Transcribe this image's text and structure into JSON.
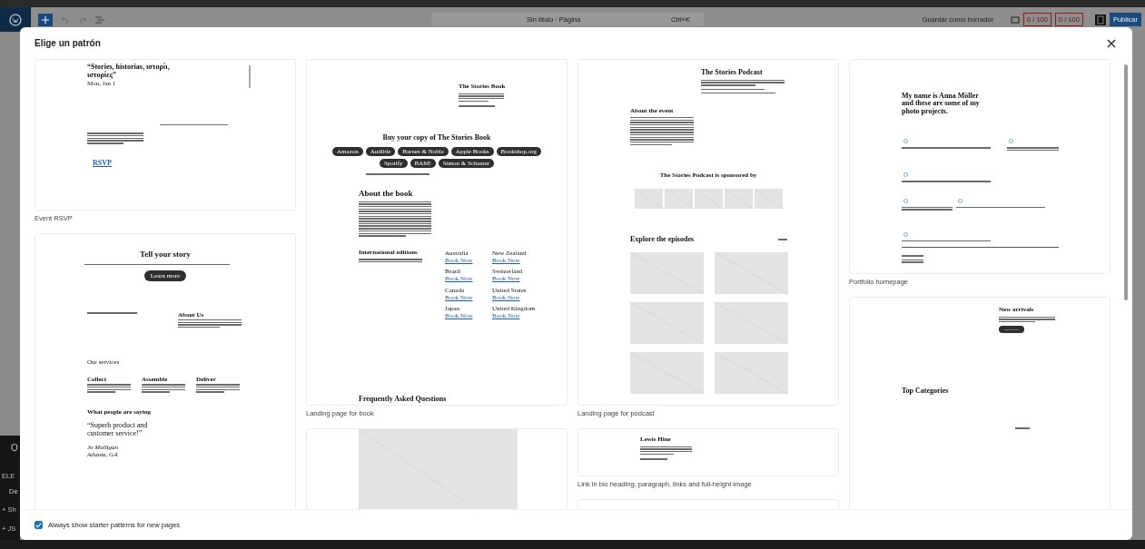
{
  "editor_bar": {
    "title": "Sin título · Página",
    "shortcut": "Ctrl+K",
    "save_draft": "Guardar como borrador",
    "counters": [
      "0 / 100",
      "0 / 100"
    ],
    "publish": "Publicar"
  },
  "side_panel": {
    "items": [
      "O",
      "ELE",
      "De",
      "+ Sh",
      "+ JS"
    ]
  },
  "modal": {
    "title": "Elige un patrón",
    "columns": [
      [
        {
          "kind": "event",
          "label": "Event RSVP",
          "heading": "“Stories, historias, ιστορίι, ιστορίες”",
          "date": "Mon, Jan 1",
          "link": "RSVP"
        },
        {
          "kind": "story",
          "heading": "Tell your story",
          "button": "Learn more",
          "about": "About Us",
          "services": "Our services",
          "service_titles": [
            "Collect",
            "Assemble",
            "Deliver"
          ],
          "quote_heading": "What people are saying",
          "quote": "“Superb product and customer service!”",
          "author": "Jo Mulligan",
          "place": "Atlanta, GA"
        }
      ],
      [
        {
          "kind": "book",
          "label": "Landing page for book",
          "title": "The Stories Book",
          "buy_heading": "Buy your copy of The Stories Book",
          "stores": [
            "Amazon",
            "Audible",
            "Barnes & Noble",
            "Apple Books",
            "Bookshop.org",
            "Spotify",
            "BAM!",
            "Simon & Schuster"
          ],
          "about": "About the book",
          "editions": "International editions",
          "countries": [
            {
              "name": "Australia",
              "link": "Book Now"
            },
            {
              "name": "Brazil",
              "link": "Book Now"
            },
            {
              "name": "Canada",
              "link": "Book Now"
            },
            {
              "name": "Japan",
              "link": "Book Now"
            },
            {
              "name": "New Zealand",
              "link": "Book Now"
            },
            {
              "name": "Switzerland",
              "link": "Book Now"
            },
            {
              "name": "United States",
              "link": "Book Now"
            },
            {
              "name": "United Kingdom",
              "link": "Book Now"
            }
          ],
          "faq": "Frequently Asked Questions"
        },
        {
          "kind": "image"
        }
      ],
      [
        {
          "kind": "podcast",
          "label": "Landing page for podcast",
          "title": "The Stories Podcast",
          "about": "About the event",
          "sponsored": "The Stories Podcast is sponsored by",
          "episodes": "Explore the episodes"
        },
        {
          "kind": "bio",
          "label": "Link in bio heading, paragraph, links and full-height image",
          "name": "Lewis Hine"
        },
        {
          "kind": "blank"
        }
      ],
      [
        {
          "kind": "portfolio",
          "label": "Portfolio homepage",
          "heading": "My name is Anna Möller and these are some of my photo projects."
        },
        {
          "kind": "shop",
          "heading": "New arrivals",
          "categories": "Top Categories"
        }
      ]
    ],
    "footer": {
      "label": "Always show starter patterns for new pages",
      "checked": true
    }
  }
}
